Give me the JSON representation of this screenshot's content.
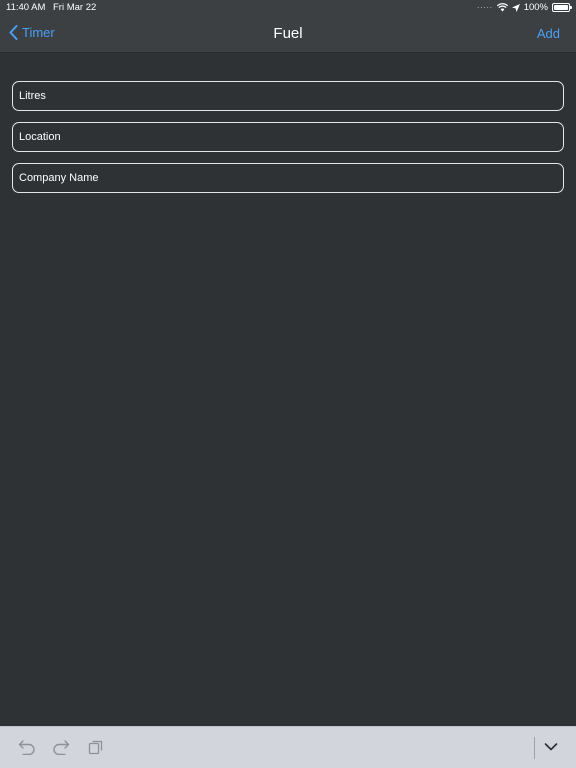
{
  "status_bar": {
    "time": "11:40 AM",
    "date": "Fri Mar 22",
    "battery": "100%",
    "battery_level": 1.0,
    "icons": [
      "signal-dots-icon",
      "wifi-icon",
      "location-arrow-icon",
      "battery-icon"
    ]
  },
  "nav": {
    "back_label": "Timer",
    "title": "Fuel",
    "add_label": "Add"
  },
  "form": {
    "fields": [
      {
        "placeholder": "Litres",
        "value": ""
      },
      {
        "placeholder": "Location",
        "value": ""
      },
      {
        "placeholder": "Company Name",
        "value": ""
      }
    ]
  },
  "keyboard_toolbar": {
    "icons": [
      "undo-icon",
      "redo-icon",
      "paste-icon",
      "chevron-down-icon"
    ]
  },
  "colors": {
    "background": "#2f3235",
    "bar": "#3d4043",
    "accent": "#4a9ff5",
    "toolbar": "#d2d5db"
  }
}
